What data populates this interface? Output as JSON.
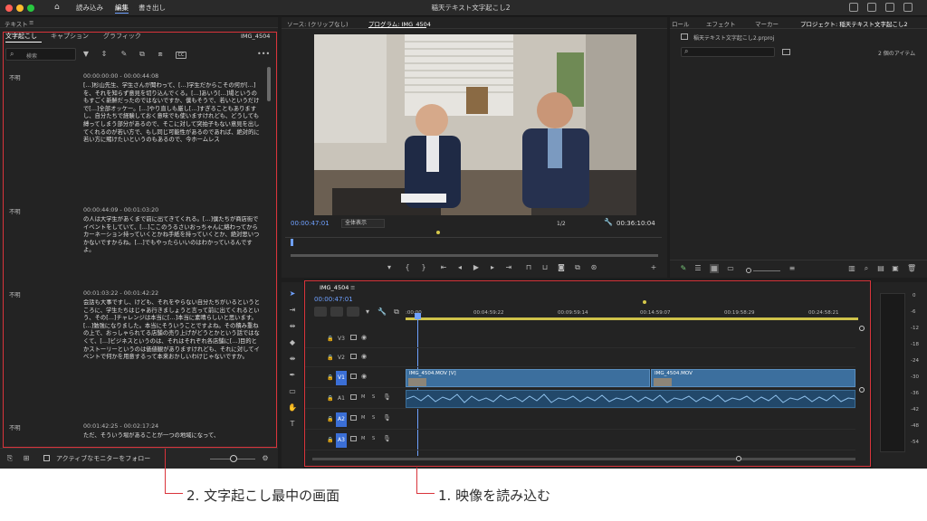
{
  "app": {
    "menus": [
      "読み込み",
      "編集",
      "書き出し"
    ],
    "active_menu": "編集",
    "title": "稲天テキスト文字起こし2"
  },
  "text_panel": {
    "header": "テキスト",
    "tabs": [
      "文字起こし",
      "キャプション",
      "グラフィック"
    ],
    "clip_name": "IMG_4504",
    "search_placeholder": "検索",
    "blocks": [
      {
        "speaker": "不明",
        "time": "00:00:00:00 - 00:00:44:08",
        "text": "[…]杉山先生、学生さんが聞わって、[…]学生だからこその何が[…]を、それを知らず意見を切り込んでくる。[…]あいう[…]場というのもすごく新鮮だったのではないですか、僕もそうで、若いというだけで[…]全部オッケー。[…]やり直しも厳し[…]すぎることもありますし、自分たちで経験しておく意味でも使いますけれども、どうしても縛ってしまう部分があるので、そこに対して突拍子もない意見を出してくれるのが若い方で、もし同じ可能性があるのであれば、絶対的に若い方に賭けたいというのもあるので、今ホームレス"
      },
      {
        "speaker": "不明",
        "time": "00:00:44:09 - 00:01:03:20",
        "text": "の人は大学生があくまで前に出てきてくれる。[…]僕たちが商店街でイベントをしていて、[…]ここのうるさいおっちゃんに絡わってからカーネーション持っていくとかね手紙を持っていくとか、絶対思いつかないですからね。[…]でもやったらいいのはわかっているんですよ。"
      },
      {
        "speaker": "不明",
        "time": "00:01:03:22 - 00:01:42:22",
        "text": "会話も大事ですし、けども、それをやらない自分たちがいるというところに、学生たちはじゃあ行きましょうと言って前に出てくれるという、その[…]チャレンジは本当に[…]本当に素晴らしいと思います。[…]勉強になりました。本当にそういうことですよね。その積み重ねの上で、おっしゃられてる店舗の売り上げがどうとかという話ではなくて、[…]ビジネスというのは、それはそれぞれ各店舗に[…]目的とかストーリーというのは価値観がありますけれども、それに対してイベントで何かを用意するって本来おかしいわけじゃないですか。"
      },
      {
        "speaker": "不明",
        "time": "00:01:42:25 - 00:02:17:24",
        "text": "ただ、そういう場があることが一つの地域になって、"
      }
    ],
    "follow_label": "アクティブなモニターをフォロー"
  },
  "program_panel": {
    "source_tab": "ソース: (クリップなし)",
    "program_tab": "プログラム: IMG_4504",
    "current_time": "00:00:47:01",
    "fit_label": "全体表示",
    "quality": "1/2",
    "duration": "00:36:10:04"
  },
  "right_panel": {
    "tabs": [
      "ロール",
      "エフェクト",
      "マーカー",
      "プロジェクト: 稲天テキスト文字起こし2"
    ],
    "project_file": "稲天テキスト文字起こし2.prproj",
    "item_count": "2 個のアイテム"
  },
  "timeline": {
    "sequence": "IMG_4504",
    "current_time": "00:00:47:01",
    "ruler": [
      ":00:00",
      "00:04:59:22",
      "00:09:59:14",
      "00:14:59:07",
      "00:19:58:29",
      "00:24:58:21"
    ],
    "tracks_video": [
      "V3",
      "V2",
      "V1"
    ],
    "tracks_audio": [
      "A1",
      "A2",
      "A3"
    ],
    "clip_v1": "IMG_4504.MOV [V]",
    "clip_v1b": "IMG_4504.MOV"
  },
  "meter": {
    "scale": [
      "0",
      "-6",
      "-12",
      "-18",
      "-24",
      "-30",
      "-36",
      "-42",
      "-48",
      "-54"
    ]
  },
  "annotations": {
    "caption_left": "2. 文字起こし最中の画面",
    "caption_right": "1. 映像を読み込む"
  },
  "colors": {
    "accent": "#6fa1ff",
    "annotation": "#d9343b",
    "clip": "#3c6f9e"
  }
}
